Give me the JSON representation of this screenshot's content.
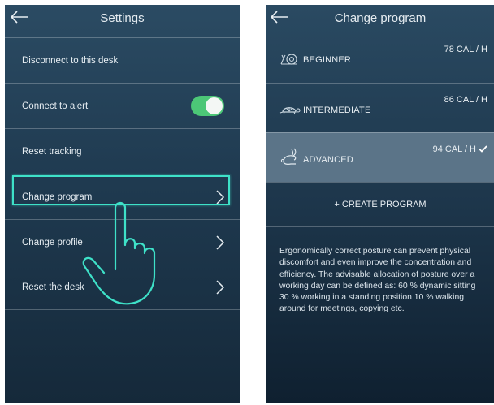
{
  "settings": {
    "title": "Settings",
    "items": [
      {
        "label": "Disconnect to this desk"
      },
      {
        "label": "Connect to alert",
        "toggle_on": true
      },
      {
        "label": "Reset tracking"
      },
      {
        "label": "Change program"
      },
      {
        "label": "Change profile"
      },
      {
        "label": "Reset the desk"
      }
    ]
  },
  "change_program": {
    "title": "Change program",
    "programs": [
      {
        "name": "BEGINNER",
        "calories": "78 CAL / H",
        "icon": "snail-icon",
        "selected": false
      },
      {
        "name": "INTERMEDIATE",
        "calories": "86 CAL / H",
        "icon": "turtle-icon",
        "selected": false
      },
      {
        "name": "ADVANCED",
        "calories": "94 CAL / H",
        "icon": "rabbit-icon",
        "selected": true
      }
    ],
    "create_label": "+ CREATE PROGRAM",
    "description": "Ergonomically correct posture can prevent physical discomfort and even improve the concentration and efficiency. The advisable allocation of posture over a working day can be defined as: 60 % dynamic sitting 30 % working in a standing position 10 % walking around for meetings, copying etc."
  },
  "colors": {
    "toggle_on": "#4cc777",
    "highlight": "#3ee1c8",
    "selected_row": "#5b7488"
  }
}
